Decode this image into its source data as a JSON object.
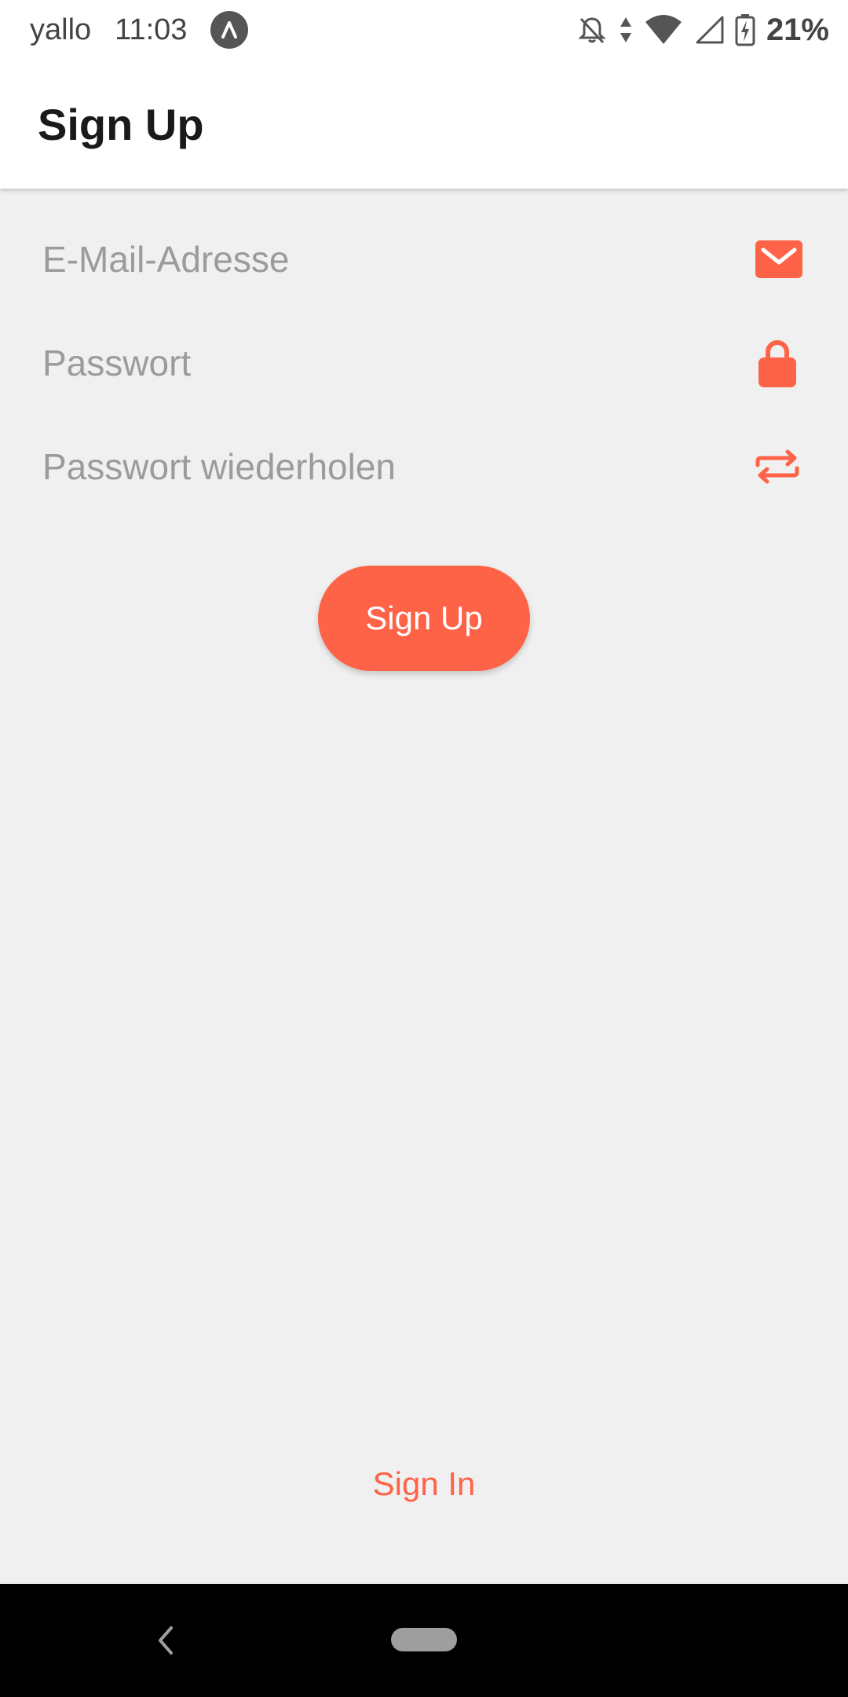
{
  "status_bar": {
    "carrier": "yallo",
    "time": "11:03",
    "battery": "21%"
  },
  "toolbar": {
    "title": "Sign Up"
  },
  "form": {
    "email_placeholder": "E-Mail-Adresse",
    "password_placeholder": "Passwort",
    "repeat_password_placeholder": "Passwort wiederholen"
  },
  "actions": {
    "sign_up_label": "Sign Up",
    "sign_in_label": "Sign In"
  },
  "colors": {
    "accent": "#ff6347",
    "background": "#f0f0f0",
    "placeholder": "#9b9b9b"
  },
  "icons": {
    "email": "envelope-icon",
    "password": "lock-icon",
    "repeat": "repeat-icon"
  }
}
